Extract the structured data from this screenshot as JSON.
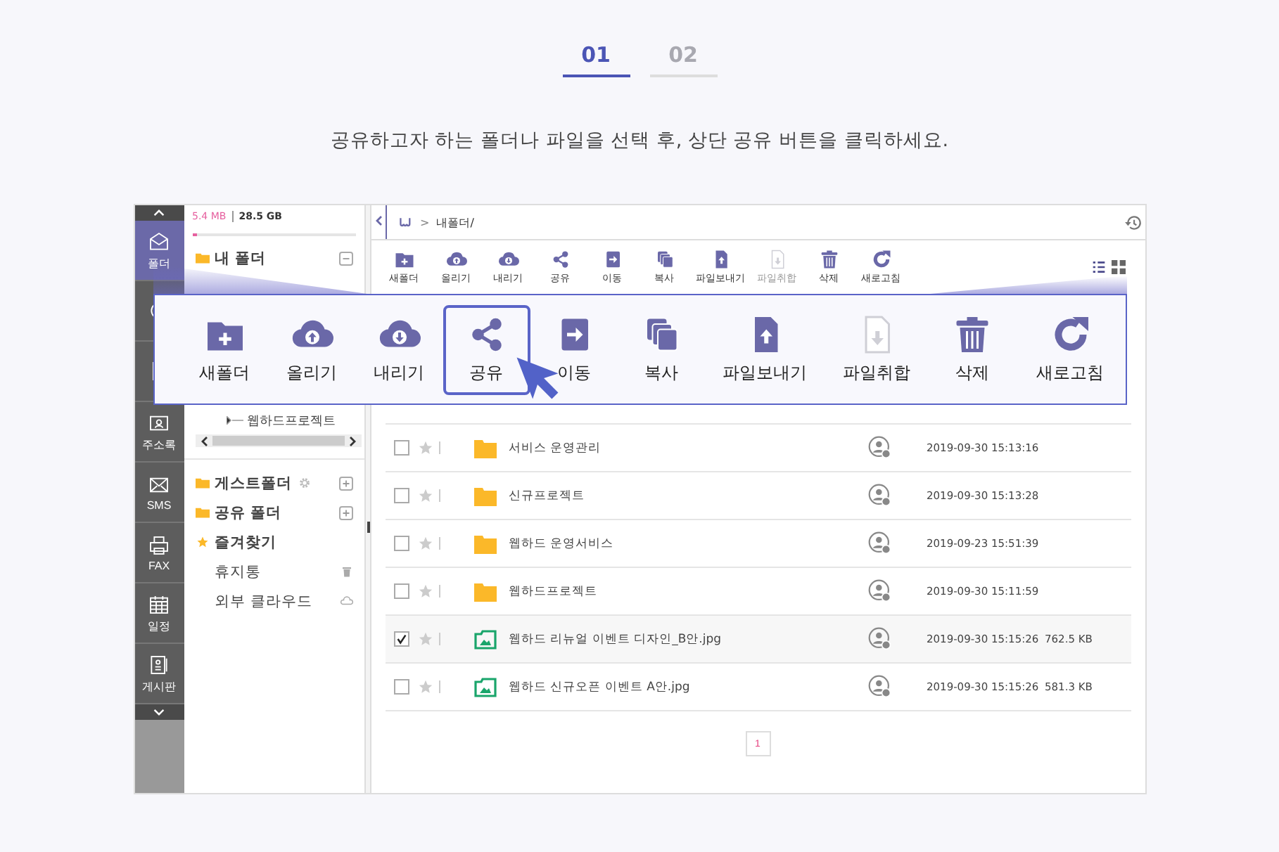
{
  "steps": [
    {
      "label": "01",
      "selected": true
    },
    {
      "label": "02",
      "selected": false
    }
  ],
  "instruction": "공유하고자 하는 폴더나 파일을 선택 후, 상단 공유 버튼을 클릭하세요.",
  "rail": {
    "items": [
      {
        "kind": "mail",
        "label": "폴더",
        "selected": true
      },
      {
        "kind": "clock",
        "selected": false
      },
      {
        "kind": "doc",
        "selected": false
      },
      {
        "kind": "contact",
        "label": "주소록",
        "selected": false
      },
      {
        "kind": "sms",
        "label": "SMS",
        "selected": false
      },
      {
        "kind": "fax",
        "label": "FAX",
        "selected": false
      },
      {
        "kind": "calendar",
        "label": "일정",
        "selected": false
      },
      {
        "kind": "board",
        "label": "게시판",
        "selected": false
      }
    ]
  },
  "storage": {
    "used": "5.4 MB",
    "total": "28.5 GB",
    "level": 0.03
  },
  "tree": {
    "my_folder": {
      "label": "내 폴더",
      "expanded": true,
      "children": [
        {
          "label": "웹하드프로젝트"
        }
      ]
    },
    "items": [
      {
        "kind": "guest",
        "label": "게스트폴더"
      },
      {
        "kind": "shared",
        "label": "공유 폴더"
      },
      {
        "kind": "favorites",
        "label": "즐겨찾기"
      },
      {
        "kind": "trash",
        "label": "휴지통"
      },
      {
        "kind": "cloud",
        "label": "외부 클라우드"
      }
    ]
  },
  "path": {
    "separator": ">",
    "current": "내폴더/"
  },
  "toolbar": [
    {
      "kind": "new-folder",
      "label": "새폴더",
      "disabled": false
    },
    {
      "kind": "upload",
      "label": "올리기",
      "disabled": false
    },
    {
      "kind": "download",
      "label": "내리기",
      "disabled": false
    },
    {
      "kind": "share",
      "label": "공유",
      "disabled": false
    },
    {
      "kind": "move",
      "label": "이동",
      "disabled": false
    },
    {
      "kind": "copy",
      "label": "복사",
      "disabled": false
    },
    {
      "kind": "send",
      "label": "파일보내기",
      "disabled": false
    },
    {
      "kind": "merge",
      "label": "파일취합",
      "disabled": true
    },
    {
      "kind": "delete",
      "label": "삭제",
      "disabled": false
    },
    {
      "kind": "refresh",
      "label": "새로고침",
      "disabled": false
    }
  ],
  "view_modes": [
    {
      "kind": "list",
      "selected": true
    },
    {
      "kind": "grid",
      "selected": false
    }
  ],
  "callout": [
    {
      "kind": "new-folder",
      "label": "새폴더",
      "disabled": false,
      "selected": false
    },
    {
      "kind": "upload",
      "label": "올리기",
      "disabled": false,
      "selected": false
    },
    {
      "kind": "download",
      "label": "내리기",
      "disabled": false,
      "selected": false
    },
    {
      "kind": "share",
      "label": "공유",
      "disabled": false,
      "selected": true
    },
    {
      "kind": "move",
      "label": "이동",
      "disabled": false,
      "selected": false
    },
    {
      "kind": "copy",
      "label": "복사",
      "disabled": false,
      "selected": false
    },
    {
      "kind": "send",
      "label": "파일보내기",
      "disabled": false,
      "selected": false
    },
    {
      "kind": "merge",
      "label": "파일취합",
      "disabled": true,
      "selected": false
    },
    {
      "kind": "delete",
      "label": "삭제",
      "disabled": false,
      "selected": false
    },
    {
      "kind": "refresh",
      "label": "새로고침",
      "disabled": false,
      "selected": false
    }
  ],
  "files": [
    {
      "kind": "folder",
      "name": "서비스 운영관리",
      "date": "2019-09-30 15:13:16",
      "checked": false
    },
    {
      "kind": "folder",
      "name": "신규프로젝트",
      "date": "2019-09-30 15:13:28",
      "checked": false
    },
    {
      "kind": "folder",
      "name": "웹하드 운영서비스",
      "date": "2019-09-23 15:51:39",
      "checked": false
    },
    {
      "kind": "folder",
      "name": "웹하드프로젝트",
      "date": "2019-09-30 15:11:59",
      "checked": false
    },
    {
      "kind": "image",
      "name": "웹하드 리뉴얼 이벤트 디자인_B안.jpg",
      "date": "2019-09-30 15:15:26",
      "size": "762.5 KB",
      "checked": true
    },
    {
      "kind": "image",
      "name": "웹하드 신규오픈 이벤트 A안.jpg",
      "date": "2019-09-30 15:15:26",
      "size": "581.3 KB",
      "checked": false
    }
  ],
  "pagination": [
    {
      "label": "1",
      "selected": true
    }
  ]
}
